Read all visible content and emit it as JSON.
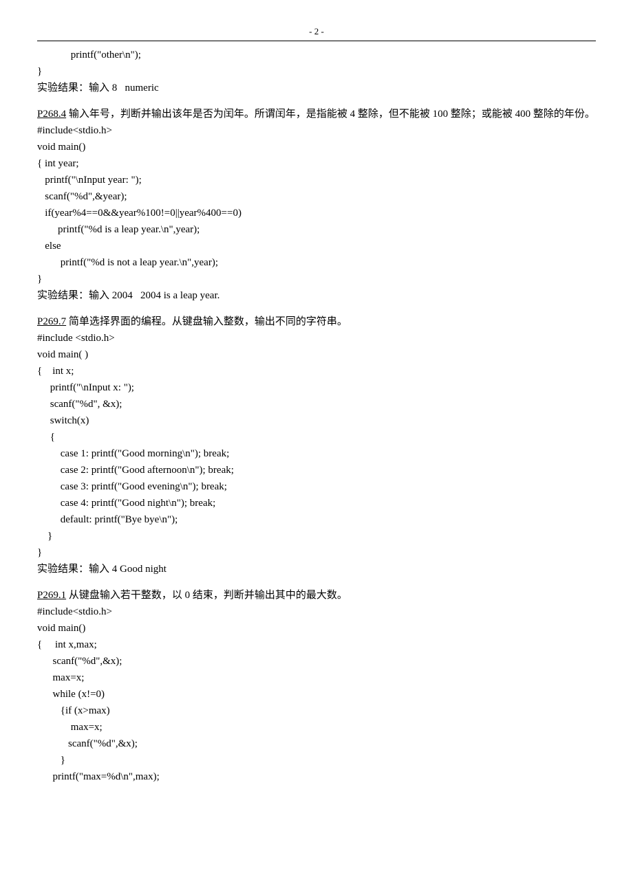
{
  "header": {
    "page_number": "- 2 -"
  },
  "cont_prev": {
    "l1": "             printf(\"other\\n\");",
    "l2": "}",
    "result": "实验结果：输入 8   numeric"
  },
  "p268_4": {
    "label": "P268.4",
    "title": " 输入年号，判断并输出该年是否为闰年。所谓闰年，是指能被 4 整除，但不能被 100 整除；或能被 400 整除的年份。",
    "code": {
      "l1": "#include<stdio.h>",
      "l2": "void main()",
      "l3": "{ int year;",
      "l4": "   printf(\"\\nInput year: \");",
      "l5": "   scanf(\"%d\",&year);",
      "l6": "   if(year%4==0&&year%100!=0||year%400==0)",
      "l7": "        printf(\"%d is a leap year.\\n\",year);",
      "l8": "   else",
      "l9": "         printf(\"%d is not a leap year.\\n\",year);",
      "l10": "}"
    },
    "result": "实验结果：输入 2004   2004 is a leap year."
  },
  "p269_7": {
    "label": "P269.7",
    "title": " 简单选择界面的编程。从键盘输入整数，输出不同的字符串。",
    "code": {
      "l1": "#include <stdio.h>",
      "l2": "void main( )",
      "l3": "{    int x;",
      "l4": "     printf(\"\\nInput x: \");",
      "l5": "     scanf(\"%d\", &x);",
      "l6": "     switch(x)",
      "l7": "     {",
      "l8": "         case 1: printf(\"Good morning\\n\"); break;",
      "l9": "         case 2: printf(\"Good afternoon\\n\"); break;",
      "l10": "         case 3: printf(\"Good evening\\n\"); break;",
      "l11": "         case 4: printf(\"Good night\\n\"); break;",
      "l12": "         default: printf(\"Bye bye\\n\");",
      "l13": "    }",
      "l14": "}"
    },
    "result": "实验结果：输入 4 Good night"
  },
  "p269_1": {
    "label": "P269.1",
    "title": " 从键盘输入若干整数，以 0 结束，判断并输出其中的最大数。",
    "code": {
      "l1": "#include<stdio.h>",
      "l2": "void main()",
      "l3": "{     int x,max;",
      "l4": "      scanf(\"%d\",&x);",
      "l5": "      max=x;",
      "l6": "      while (x!=0)",
      "l7": "         {if (x>max)",
      "l8": "             max=x;",
      "l9": "            scanf(\"%d\",&x);",
      "l10": "         }",
      "l11": "      printf(\"max=%d\\n\",max);"
    }
  }
}
